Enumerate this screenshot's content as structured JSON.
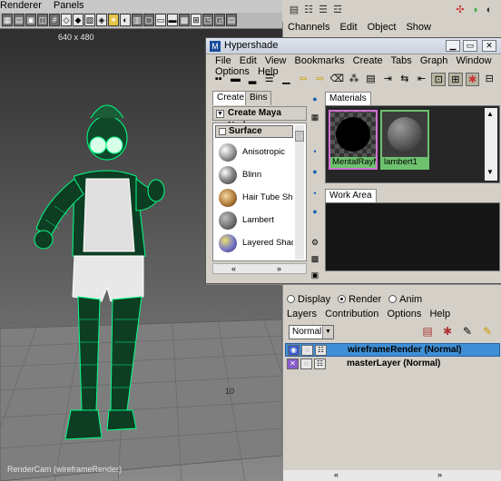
{
  "viewport": {
    "menu": [
      "Renderer",
      "Panels"
    ],
    "resolution_label": "640 x 480",
    "camera_label": "RenderCam (wireframeRender)",
    "grid_label": "10"
  },
  "channel_box": {
    "menu": [
      "Channels",
      "Edit",
      "Object",
      "Show"
    ]
  },
  "hypershade": {
    "title": "Hypershade",
    "menu": [
      "File",
      "Edit",
      "View",
      "Bookmarks",
      "Create",
      "Tabs",
      "Graph",
      "Window",
      "Options",
      "Help"
    ],
    "tabs": [
      "Create",
      "Bins"
    ],
    "create_node_label": "Create Maya Nodes",
    "category_label": "Surface",
    "shaders": [
      {
        "label": "Anisotropic",
        "color": "#9a9a9a"
      },
      {
        "label": "Blinn",
        "color": "#8a8a8a"
      },
      {
        "label": "Hair Tube Shader",
        "color": "#b07a3a"
      },
      {
        "label": "Lambert",
        "color": "#7a7a7a"
      },
      {
        "label": "Layered Shader",
        "color": "#7878c8"
      }
    ],
    "materials_tab": "Materials",
    "materials": [
      {
        "label": "MentalRayMaterial"
      },
      {
        "label": "lambert1"
      }
    ],
    "workarea_tab": "Work Area"
  },
  "render_layers": {
    "modes": [
      {
        "label": "Display",
        "selected": false
      },
      {
        "label": "Render",
        "selected": true
      },
      {
        "label": "Anim",
        "selected": false
      }
    ],
    "menu": [
      "Layers",
      "Contribution",
      "Options",
      "Help"
    ],
    "blend_mode": "Normal",
    "layers": [
      {
        "name": "wireframeRender (Normal)",
        "selected": true
      },
      {
        "name": "masterLayer (Normal)",
        "selected": false
      }
    ]
  },
  "colors": {
    "wireframe": "#00ff88",
    "selected_layer": "#3f8fd6",
    "material_label_bg": "#6ec26e",
    "viewport_bg": "#444444"
  }
}
